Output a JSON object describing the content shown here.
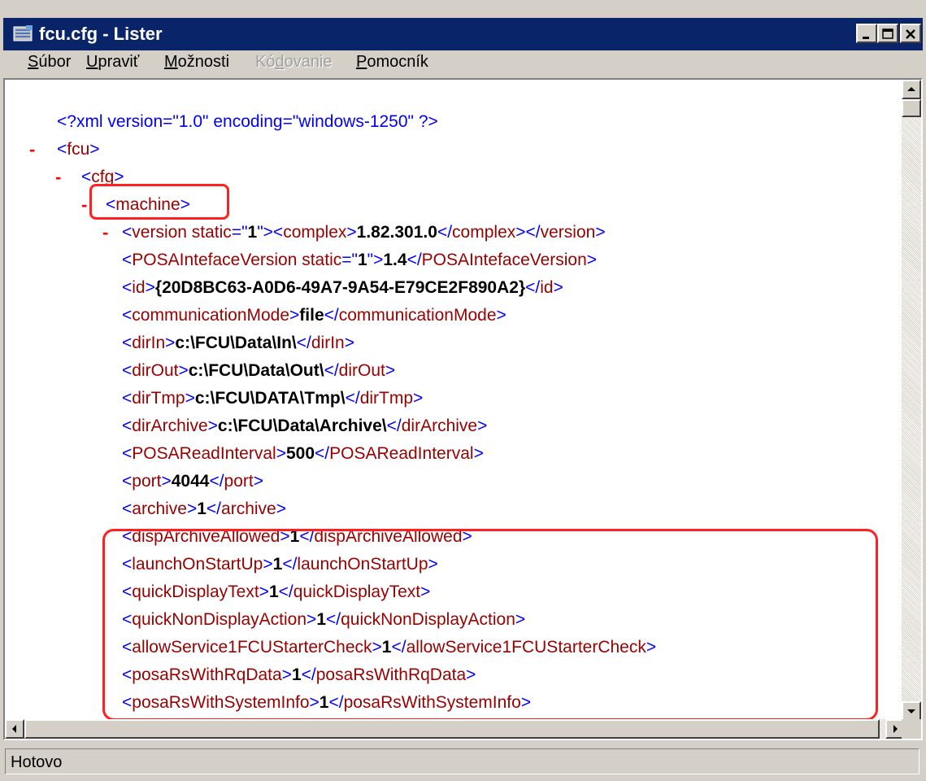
{
  "window": {
    "title": "fcu.cfg - Lister"
  },
  "menu": {
    "items": [
      {
        "pre": "",
        "key": "S",
        "post": "úbor",
        "disabled": false
      },
      {
        "pre": "",
        "key": "U",
        "post": "praviť",
        "disabled": false
      },
      {
        "pre": "",
        "key": "M",
        "post": "ožnosti",
        "disabled": false
      },
      {
        "pre": "Kó",
        "key": "d",
        "post": "ovanie",
        "disabled": true
      },
      {
        "pre": "",
        "key": "P",
        "post": "omocník",
        "disabled": false
      }
    ]
  },
  "xml": {
    "declaration": "<?xml version=\"1.0\" encoding=\"windows-1250\" ?>",
    "fcu_open": "<fcu>",
    "cfg_open": "<cfg>",
    "machine_open": "<machine>",
    "collapse_marker": "-",
    "version_line": {
      "open": "<version static=\"",
      "attr": "1",
      "close_attr": "\">",
      "inner_open": "<complex>",
      "value": "1.82.301.0",
      "inner_close": "</complex>",
      "close": "</version>"
    },
    "posa_iface": {
      "open": "<POSAIntefaceVersion static=\"",
      "attr": "1",
      "close_attr": "\">",
      "value": "1.4",
      "close": "</POSAIntefaceVersion>"
    },
    "elements": [
      {
        "open": "<id>",
        "value": "{20D8BC63-A0D6-49A7-9A54-E79CE2F890A2}",
        "close": "</id>"
      },
      {
        "open": "<communicationMode>",
        "value": "file",
        "close": "</communicationMode>"
      },
      {
        "open": "<dirIn>",
        "value": "c:\\FCU\\Data\\In\\",
        "close": "</dirIn>"
      },
      {
        "open": "<dirOut>",
        "value": "c:\\FCU\\Data\\Out\\",
        "close": "</dirOut>"
      },
      {
        "open": "<dirTmp>",
        "value": "c:\\FCU\\DATA\\Tmp\\",
        "close": "</dirTmp>"
      },
      {
        "open": "<dirArchive>",
        "value": "c:\\FCU\\Data\\Archive\\",
        "close": "</dirArchive>"
      },
      {
        "open": "<POSAReadInterval>",
        "value": "500",
        "close": "</POSAReadInterval>"
      },
      {
        "open": "<port>",
        "value": "4044",
        "close": "</port>"
      },
      {
        "open": "<archive>",
        "value": "1",
        "close": "</archive>"
      },
      {
        "open": "<dispArchiveAllowed>",
        "value": "1",
        "close": "</dispArchiveAllowed>"
      },
      {
        "open": "<launchOnStartUp>",
        "value": "1",
        "close": "</launchOnStartUp>"
      },
      {
        "open": "<quickDisplayText>",
        "value": "1",
        "close": "</quickDisplayText>"
      },
      {
        "open": "<quickNonDisplayAction>",
        "value": "1",
        "close": "</quickNonDisplayAction>"
      },
      {
        "open": "<allowService1FCUStarterCheck>",
        "value": "1",
        "close": "</allowService1FCUStarterCheck>"
      },
      {
        "open": "<posaRsWithRqData>",
        "value": "1",
        "close": "</posaRsWithRqData>"
      },
      {
        "open": "<posaRsWithSystemInfo>",
        "value": "1",
        "close": "</posaRsWithSystemInfo>"
      }
    ]
  },
  "status": {
    "text": "Hotovo"
  },
  "colors": {
    "title_bar": "#0a246a",
    "tag": "#0000ff",
    "tag_name": "#990000",
    "highlight": "#ff2020"
  },
  "icons": {
    "app": "lister-app-icon",
    "minimize": "minimize-icon",
    "maximize": "maximize-icon",
    "close": "close-icon"
  }
}
